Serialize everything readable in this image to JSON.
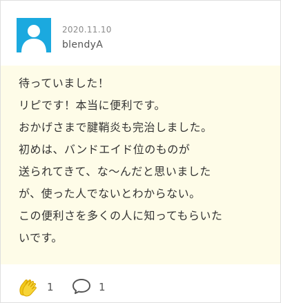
{
  "review": {
    "date": "2020.11.10",
    "username": "blendyA",
    "lines": [
      "待っていました！",
      "リピです！本当に便利です。",
      "おかげさまで腱鞘炎も完治しました。",
      "初めは、バンドエイド位のものが",
      "送られてきて、な～んだと思いました",
      "が、使った人でないとわからない。",
      "この便利さを多くの人に知ってもらいた",
      "いです。"
    ]
  },
  "actions": {
    "clap_count": "1",
    "comment_count": "1"
  },
  "colors": {
    "avatar": "#1ba9df",
    "body_background": "#fefce8",
    "clap_icon": "#f2c81a"
  },
  "icons": {
    "avatar": "default-user-icon",
    "clap": "clapping-hands-icon",
    "comment": "speech-bubble-icon"
  }
}
